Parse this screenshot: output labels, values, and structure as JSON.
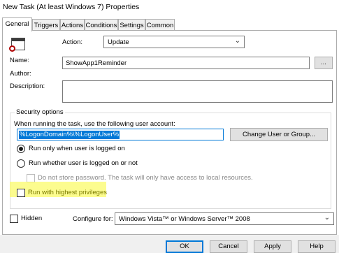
{
  "window": {
    "title": "New Task (At least Windows 7) Properties"
  },
  "tabs": [
    {
      "label": "General"
    },
    {
      "label": "Triggers"
    },
    {
      "label": "Actions"
    },
    {
      "label": "Conditions"
    },
    {
      "label": "Settings"
    },
    {
      "label": "Common"
    }
  ],
  "general": {
    "action_label": "Action:",
    "action_value": "Update",
    "name_label": "Name:",
    "name_value": "ShowApp1Reminder",
    "browse_label": "...",
    "author_label": "Author:",
    "description_label": "Description:",
    "description_value": ""
  },
  "security": {
    "group_title": "Security options",
    "account_prompt": "When running the task, use the following user account:",
    "user_account": "%LogonDomain%\\%LogonUser%",
    "change_button": "Change User or Group...",
    "radio_logged_on": "Run only when user is logged on",
    "radio_logged_on_or_not": "Run whether user is logged on or not",
    "no_store_password": "Do not store password. The task will only have access to local resources.",
    "highest_privileges": "Run with highest privileges"
  },
  "footer": {
    "hidden_label": "Hidden",
    "configure_label": "Configure for:",
    "configure_value": "Windows Vista™ or Windows Server™ 2008"
  },
  "buttons": {
    "ok": "OK",
    "cancel": "Cancel",
    "apply": "Apply",
    "help": "Help"
  },
  "colors": {
    "accent": "#0078d7",
    "highlight": "#fbfb6a"
  }
}
